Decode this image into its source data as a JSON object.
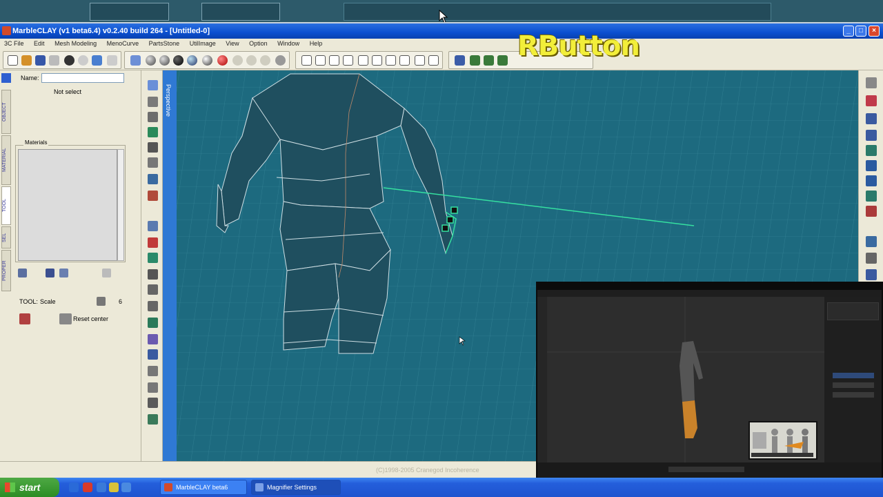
{
  "window": {
    "title": "MarbleCLAY (v1 beta6.4) v0.2.40 build 264 - [Untitled-0]",
    "minimize": "_",
    "maximize": "□",
    "close": "×"
  },
  "overlay": {
    "key_caption": "RButton"
  },
  "menu": {
    "items": [
      "3C File",
      "Edit",
      "Mesh Modeling",
      "MenoCurve",
      "PartsStone",
      "UtilImage",
      "View",
      "Option",
      "Window",
      "Help"
    ]
  },
  "side_tabs": [
    "OBJECT",
    "MATERIAL",
    "TOOL",
    "SEL",
    "PROPER"
  ],
  "left_panel": {
    "name_label": "Name:",
    "name_value": "",
    "selection_status": "Not select",
    "material_title": "Materials",
    "tool_label": "TOOL:",
    "tool_value": "Scale",
    "tool_count": "6",
    "reset_label": "Reset center"
  },
  "viewport": {
    "label": "Perspective",
    "colors": {
      "background": "#1d6a7f",
      "mesh": "#1f4f5f",
      "wire": "#cfdfe4",
      "handle": "#35e0a0"
    }
  },
  "status_bar": {
    "copyright": "(C)1998-2005 Cranegod Incoherence"
  },
  "taskbar": {
    "start_label": "start",
    "tasks": [
      "MarbleCLAY beta6",
      "Magnifier Settings"
    ]
  }
}
